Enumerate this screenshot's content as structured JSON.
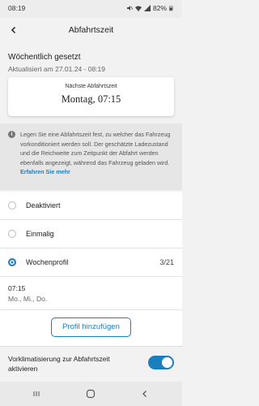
{
  "status_bar": {
    "time": "08:19",
    "battery": "82%",
    "icons": [
      "mail-icon",
      "settings-icon",
      "notification-icon",
      "mute-icon",
      "wifi-icon",
      "signal-icon",
      "battery-icon"
    ]
  },
  "app_bar": {
    "title": "Abfahrtszeit",
    "back_icon": "back-arrow-icon"
  },
  "header": {
    "title": "Wöchentlich gesetzt",
    "subtitle": "Aktualisiert am 27.01.24 - 08:19"
  },
  "next_departure": {
    "label": "Nächste Abfahrtszeit",
    "value": "Montag, 07:15"
  },
  "info": {
    "icon": "info-icon",
    "text": "Legen Sie eine Abfahrtszeit fest, zu welcher das Fahrzeug vorkonditioniert werden soll. Der geschätzte Ladezustand und die Reichweite zum Zeitpunkt der Abfahrt werden ebenfalls angezeigt, während das Fahrzeug geladen wird.",
    "link": "Erfahren Sie mehr"
  },
  "options": [
    {
      "label": "Deaktiviert",
      "selected": false
    },
    {
      "label": "Einmalig",
      "selected": false
    },
    {
      "label": "Wochenprofil",
      "selected": true,
      "count": "3/21"
    }
  ],
  "schedule": {
    "time": "07:15",
    "days": "Mo., Mi., Do."
  },
  "add_button": "Profil hinzufügen",
  "preconditioning": {
    "label": "Vorklimatisierung zur Abfahrtszeit aktivieren",
    "enabled": true
  },
  "nav": [
    "recent-apps-icon",
    "home-icon",
    "back-icon"
  ],
  "colors": {
    "accent": "#1b7fbd",
    "background": "#f2f2f2",
    "info_bg": "#e6e6e6"
  }
}
